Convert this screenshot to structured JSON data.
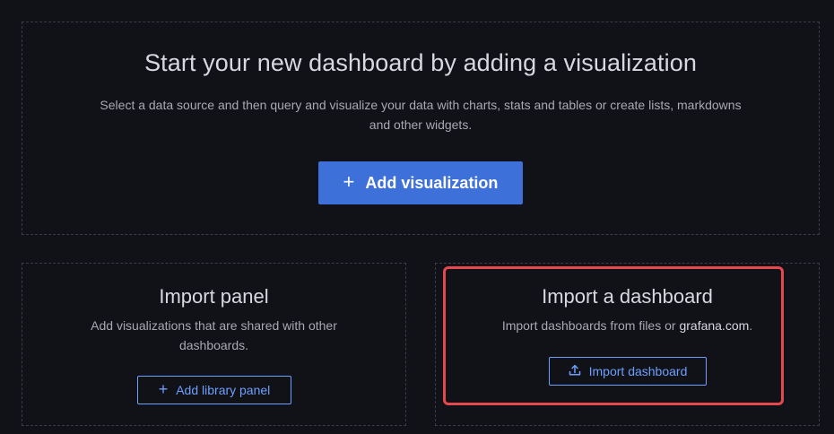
{
  "hero": {
    "title": "Start your new dashboard by adding a visualization",
    "description": "Select a data source and then query and visualize your data with charts, stats and tables or create lists, markdowns and other widgets.",
    "add_button": {
      "icon": "plus-icon",
      "label": "Add visualization"
    }
  },
  "import_panel": {
    "title": "Import panel",
    "description": "Add visualizations that are shared with other dashboards.",
    "button": {
      "icon": "plus-icon",
      "label": "Add library panel"
    }
  },
  "import_dashboard": {
    "title": "Import a dashboard",
    "description_prefix": "Import dashboards from files or ",
    "description_link": "grafana.com",
    "description_suffix": ".",
    "button": {
      "icon": "upload-icon",
      "label": "Import dashboard"
    }
  },
  "colors": {
    "background": "#111217",
    "primary": "#3d71d9",
    "link": "#6e9fff",
    "highlight": "#e5484d"
  }
}
